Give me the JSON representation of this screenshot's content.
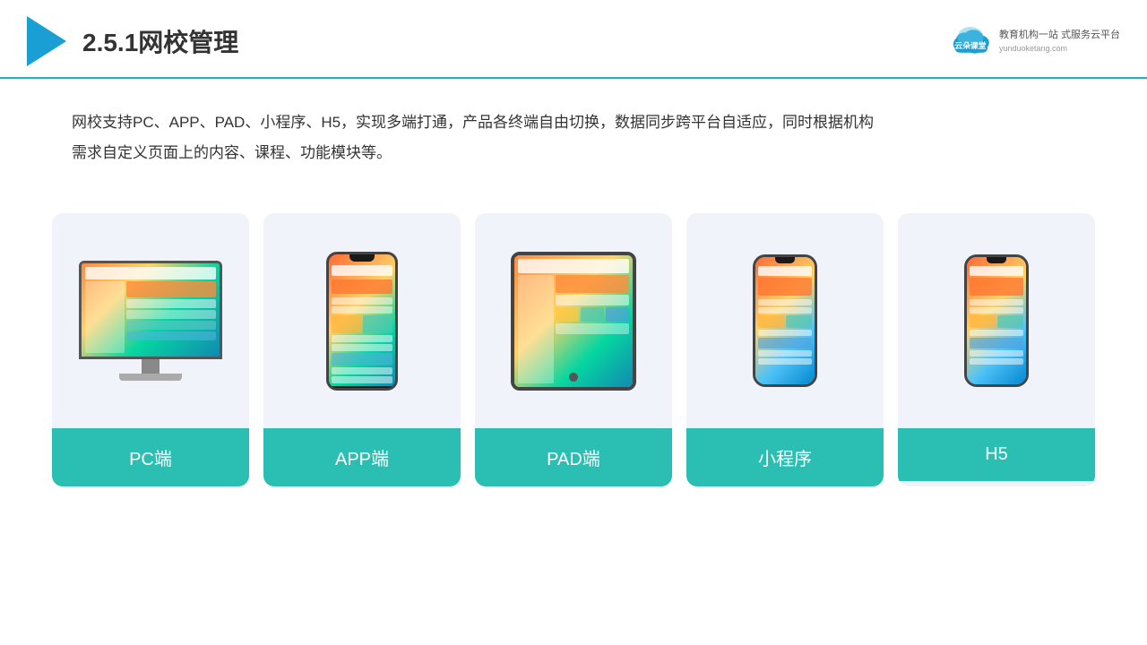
{
  "header": {
    "title": "2.5.1网校管理",
    "brand": {
      "name": "云朵课堂",
      "url": "yunduoketang.com",
      "slogan": "教育机构一站\n式服务云平台"
    }
  },
  "description": "网校支持PC、APP、PAD、小程序、H5，实现多端打通，产品各终端自由切换，数据同步跨平台自适应，同时根据机构\n需求自定义页面上的内容、课程、功能模块等。",
  "cards": [
    {
      "id": "pc",
      "label": "PC端"
    },
    {
      "id": "app",
      "label": "APP端"
    },
    {
      "id": "pad",
      "label": "PAD端"
    },
    {
      "id": "miniprogram",
      "label": "小程序"
    },
    {
      "id": "h5",
      "label": "H5"
    }
  ],
  "colors": {
    "accent": "#1a9fd4",
    "card_bg": "#f0f4fa",
    "label_bg": "#2bbfb3",
    "header_line": "#1ab3c8",
    "title_color": "#333333"
  }
}
